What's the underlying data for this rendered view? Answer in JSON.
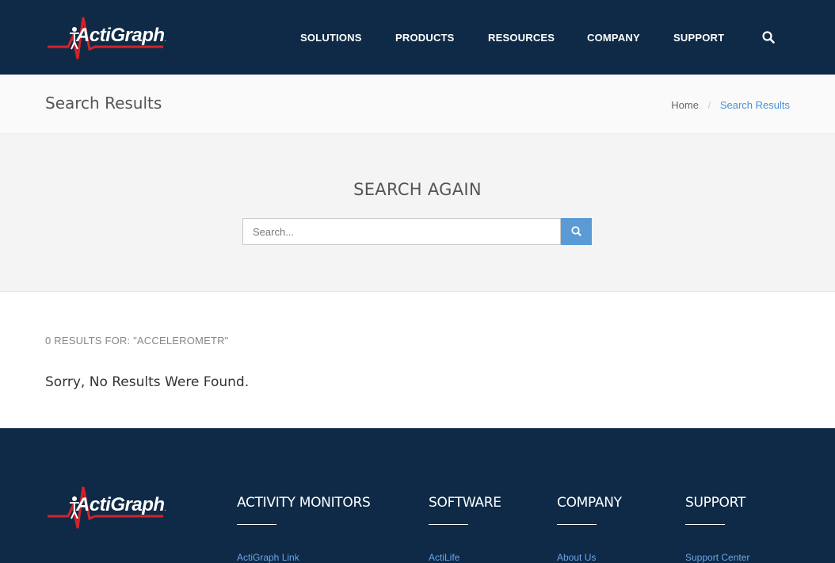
{
  "header": {
    "logo_text": "ActiGraph",
    "nav": [
      "SOLUTIONS",
      "PRODUCTS",
      "RESOURCES",
      "COMPANY",
      "SUPPORT"
    ],
    "search_icon": "search-icon"
  },
  "titlebar": {
    "title": "Search Results",
    "breadcrumb": {
      "home": "Home",
      "separator": "/",
      "current": "Search Results"
    }
  },
  "search": {
    "heading": "SEARCH AGAIN",
    "placeholder": "Search...",
    "button_icon": "search-icon"
  },
  "results": {
    "count_label": "0 RESULTS FOR: \"ACCELEROMETR\"",
    "message": "Sorry, No Results Were Found."
  },
  "footer": {
    "logo_text": "ActiGraph",
    "columns": [
      {
        "heading": "ACTIVITY MONITORS",
        "first_link": "ActiGraph Link"
      },
      {
        "heading": "SOFTWARE",
        "first_link": "ActiLife"
      },
      {
        "heading": "COMPANY",
        "first_link": "About Us"
      },
      {
        "heading": "SUPPORT",
        "first_link": "Support Center"
      }
    ]
  },
  "colors": {
    "header_bg": "#0e2a47",
    "accent": "#5b9bd5",
    "link": "#4a90d9",
    "logo_red": "#d2232a"
  }
}
